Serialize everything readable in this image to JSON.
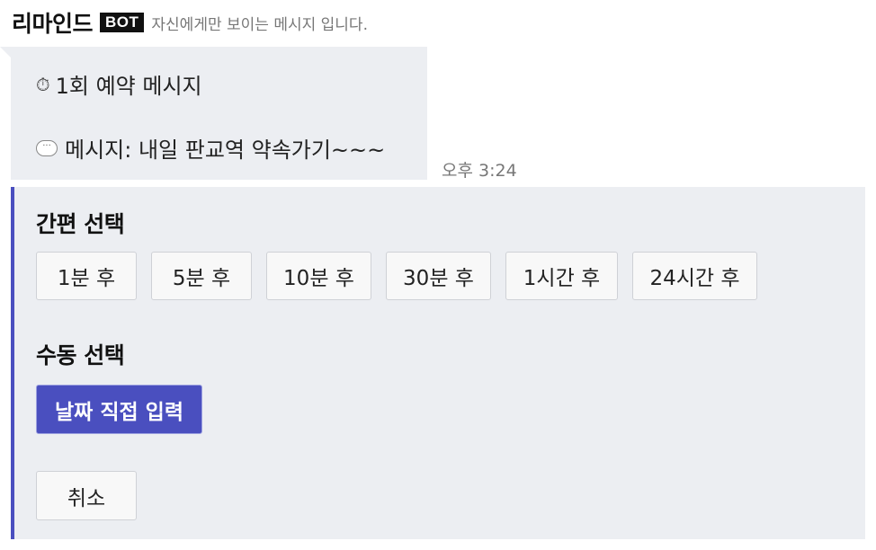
{
  "header": {
    "sender": "리마인드",
    "badge": "BOT",
    "notice": "자신에게만 보이는 메시지 입니다."
  },
  "message": {
    "line1_icon": "stopwatch-icon",
    "line1_text": "1회 예약 메시지",
    "line2_icon": "speech-bubble-icon",
    "line2_text": "메시지: 내일 판교역 약속가기~~~",
    "timestamp": "오후 3:24"
  },
  "quick_select": {
    "title": "간편 선택",
    "options": [
      "1분 후",
      "5분 후",
      "10분 후",
      "30분 후",
      "1시간 후",
      "24시간 후"
    ]
  },
  "manual_select": {
    "title": "수동 선택",
    "button": "날짜 직접 입력"
  },
  "cancel_label": "취소",
  "colors": {
    "accent": "#4a4fbf",
    "panel_bg": "#eceef2",
    "badge_bg": "#111111"
  }
}
